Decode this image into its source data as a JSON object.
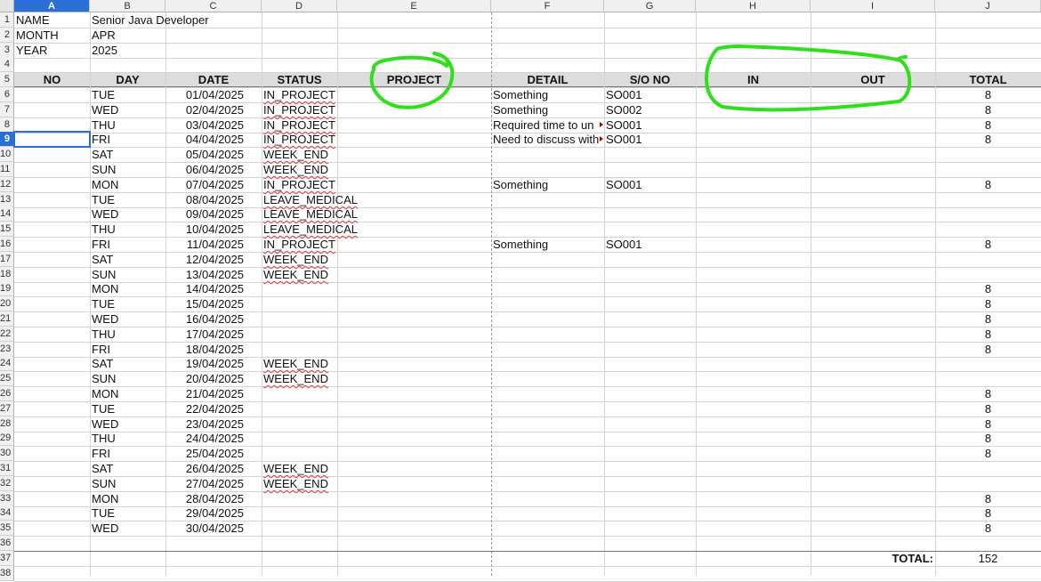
{
  "columns": [
    "A",
    "B",
    "C",
    "D",
    "E",
    "F",
    "G",
    "H",
    "I",
    "J"
  ],
  "active_col": "A",
  "active_row": 9,
  "header_rows": [
    {
      "row": 1,
      "label": "NAME",
      "value": "Senior Java Developer"
    },
    {
      "row": 2,
      "label": "MONTH",
      "value": "APR"
    },
    {
      "row": 3,
      "label": "YEAR",
      "value": "2025"
    }
  ],
  "table_headers": {
    "no": "NO",
    "day": "DAY",
    "date": "DATE",
    "status": "STATUS",
    "project": "PROJECT",
    "detail": "DETAIL",
    "so_no": "S/O NO",
    "in": "IN",
    "out": "OUT",
    "total": "TOTAL"
  },
  "rows": [
    {
      "day": "TUE",
      "date": "01/04/2025",
      "status": "IN_PROJECT",
      "detail": "Something",
      "so": "SO001",
      "total": "8"
    },
    {
      "day": "WED",
      "date": "02/04/2025",
      "status": "IN_PROJECT",
      "detail": "Something",
      "so": "SO002",
      "total": "8"
    },
    {
      "day": "THU",
      "date": "03/04/2025",
      "status": "IN_PROJECT",
      "detail": "Required time to un",
      "so": "SO001",
      "total": "8"
    },
    {
      "day": "FRI",
      "date": "04/04/2025",
      "status": "IN_PROJECT",
      "detail": "Need to discuss with",
      "so": "SO001",
      "total": "8"
    },
    {
      "day": "SAT",
      "date": "05/04/2025",
      "status": "WEEK_END",
      "detail": "",
      "so": "",
      "total": ""
    },
    {
      "day": "SUN",
      "date": "06/04/2025",
      "status": "WEEK_END",
      "detail": "",
      "so": "",
      "total": ""
    },
    {
      "day": "MON",
      "date": "07/04/2025",
      "status": "IN_PROJECT",
      "detail": "Something",
      "so": "SO001",
      "total": "8"
    },
    {
      "day": "TUE",
      "date": "08/04/2025",
      "status": "LEAVE_MEDICAL",
      "detail": "",
      "so": "",
      "total": ""
    },
    {
      "day": "WED",
      "date": "09/04/2025",
      "status": "LEAVE_MEDICAL",
      "detail": "",
      "so": "",
      "total": ""
    },
    {
      "day": "THU",
      "date": "10/04/2025",
      "status": "LEAVE_MEDICAL",
      "detail": "",
      "so": "",
      "total": ""
    },
    {
      "day": "FRI",
      "date": "11/04/2025",
      "status": "IN_PROJECT",
      "detail": "Something",
      "so": "SO001",
      "total": "8"
    },
    {
      "day": "SAT",
      "date": "12/04/2025",
      "status": "WEEK_END",
      "detail": "",
      "so": "",
      "total": ""
    },
    {
      "day": "SUN",
      "date": "13/04/2025",
      "status": "WEEK_END",
      "detail": "",
      "so": "",
      "total": ""
    },
    {
      "day": "MON",
      "date": "14/04/2025",
      "status": "",
      "detail": "",
      "so": "",
      "total": "8"
    },
    {
      "day": "TUE",
      "date": "15/04/2025",
      "status": "",
      "detail": "",
      "so": "",
      "total": "8"
    },
    {
      "day": "WED",
      "date": "16/04/2025",
      "status": "",
      "detail": "",
      "so": "",
      "total": "8"
    },
    {
      "day": "THU",
      "date": "17/04/2025",
      "status": "",
      "detail": "",
      "so": "",
      "total": "8"
    },
    {
      "day": "FRI",
      "date": "18/04/2025",
      "status": "",
      "detail": "",
      "so": "",
      "total": "8"
    },
    {
      "day": "SAT",
      "date": "19/04/2025",
      "status": "WEEK_END",
      "detail": "",
      "so": "",
      "total": ""
    },
    {
      "day": "SUN",
      "date": "20/04/2025",
      "status": "WEEK_END",
      "detail": "",
      "so": "",
      "total": ""
    },
    {
      "day": "MON",
      "date": "21/04/2025",
      "status": "",
      "detail": "",
      "so": "",
      "total": "8"
    },
    {
      "day": "TUE",
      "date": "22/04/2025",
      "status": "",
      "detail": "",
      "so": "",
      "total": "8"
    },
    {
      "day": "WED",
      "date": "23/04/2025",
      "status": "",
      "detail": "",
      "so": "",
      "total": "8"
    },
    {
      "day": "THU",
      "date": "24/04/2025",
      "status": "",
      "detail": "",
      "so": "",
      "total": "8"
    },
    {
      "day": "FRI",
      "date": "25/04/2025",
      "status": "",
      "detail": "",
      "so": "",
      "total": "8"
    },
    {
      "day": "SAT",
      "date": "26/04/2025",
      "status": "WEEK_END",
      "detail": "",
      "so": "",
      "total": ""
    },
    {
      "day": "SUN",
      "date": "27/04/2025",
      "status": "WEEK_END",
      "detail": "",
      "so": "",
      "total": ""
    },
    {
      "day": "MON",
      "date": "28/04/2025",
      "status": "",
      "detail": "",
      "so": "",
      "total": "8"
    },
    {
      "day": "TUE",
      "date": "29/04/2025",
      "status": "",
      "detail": "",
      "so": "",
      "total": "8"
    },
    {
      "day": "WED",
      "date": "30/04/2025",
      "status": "",
      "detail": "",
      "so": "",
      "total": "8"
    }
  ],
  "summary": {
    "label": "TOTAL:",
    "value": "152"
  },
  "annotation_color": "#2ee01a"
}
